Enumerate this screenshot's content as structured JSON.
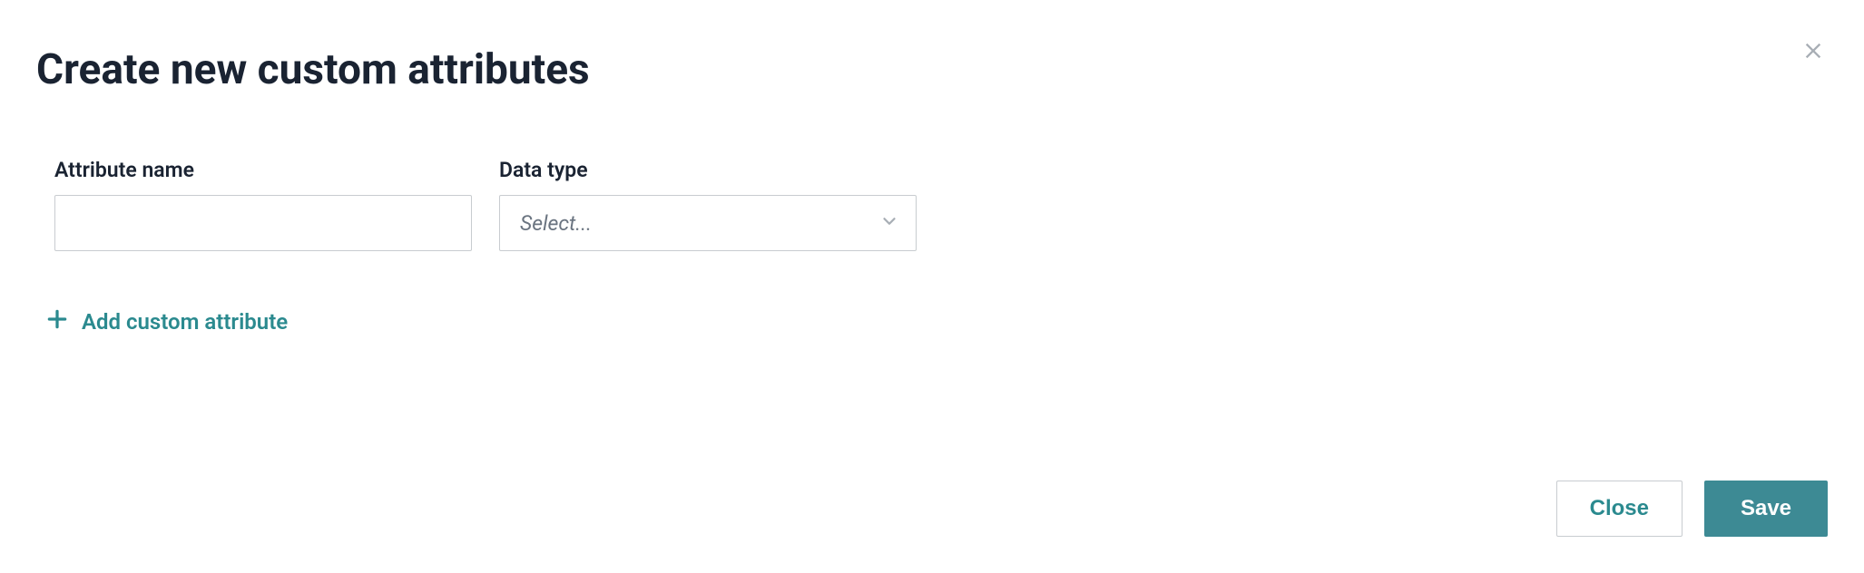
{
  "dialog": {
    "title": "Create new custom attributes"
  },
  "form": {
    "attribute_name": {
      "label": "Attribute name",
      "value": ""
    },
    "data_type": {
      "label": "Data type",
      "placeholder": "Select..."
    }
  },
  "actions": {
    "add_link": "Add custom attribute",
    "close": "Close",
    "save": "Save"
  }
}
